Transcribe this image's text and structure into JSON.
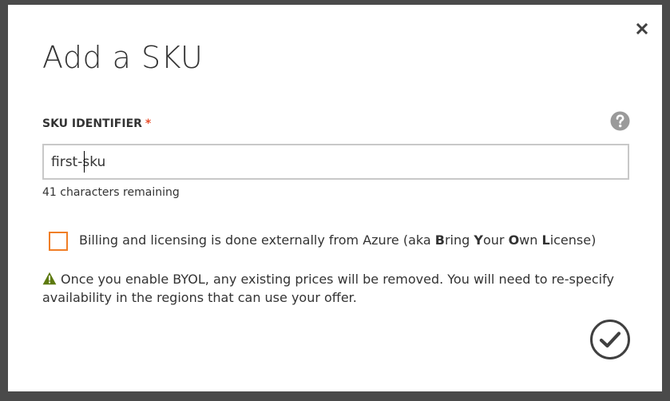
{
  "dialog": {
    "title": "Add a SKU",
    "field_label": "SKU IDENTIFIER",
    "required_mark": "*",
    "input_value": "first-sku",
    "remaining_text": "41 characters remaining",
    "byol": {
      "checked": false,
      "label_parts": [
        "Billing and licensing is done externally from Azure (aka ",
        "B",
        "ring ",
        "Y",
        "our ",
        "O",
        "wn ",
        "L",
        "icense)"
      ]
    },
    "warning_text": "Once you enable BYOL, any existing prices will be removed. You will need to re-specify availability in the regions that can use your offer.",
    "icons": {
      "close": "close-icon",
      "help": "help-icon",
      "warning": "warning-icon",
      "ok": "checkmark-icon"
    },
    "colors": {
      "backdrop": "#4a4a4a",
      "required": "#e8502e",
      "checkbox_border": "#f07e26",
      "warning": "#5d7a0f",
      "icon": "#404040"
    }
  }
}
